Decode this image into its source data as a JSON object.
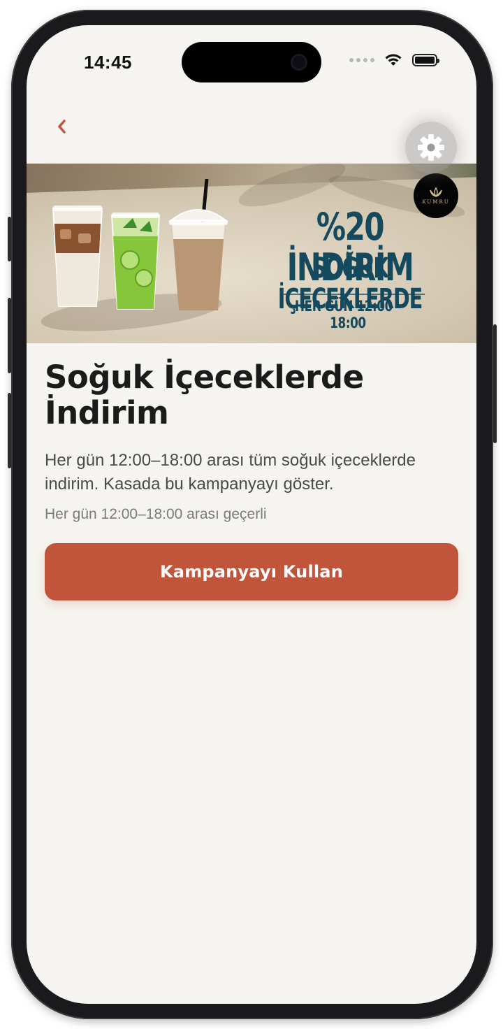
{
  "status_bar": {
    "time": "14:45",
    "icons": [
      "signal-icon",
      "wifi-icon",
      "battery-icon"
    ]
  },
  "nav": {
    "back_icon": "chevron-left-icon",
    "settings_icon": "gear-icon"
  },
  "banner": {
    "headline": "%20 İNDİRİM",
    "subheadline": "SOĞUK İÇECEKLERDE",
    "hours": "HER GÜN 12:00 - 18:00",
    "brand_logo_text": "KUMRU"
  },
  "campaign": {
    "title": "Soğuk İçeceklerde İndirim",
    "description": "Her gün 12:00–18:00 arası tüm soğuk içeceklerde indirim. Kasada bu kampanyayı göster.",
    "validity": "Her gün 12:00–18:00 arası geçerli",
    "cta_label": "Kampanyayı Kullan"
  },
  "colors": {
    "accent": "#c1553b",
    "background": "#f6f4f0",
    "banner_text": "#14495e",
    "title_text": "#1b1b1b"
  }
}
